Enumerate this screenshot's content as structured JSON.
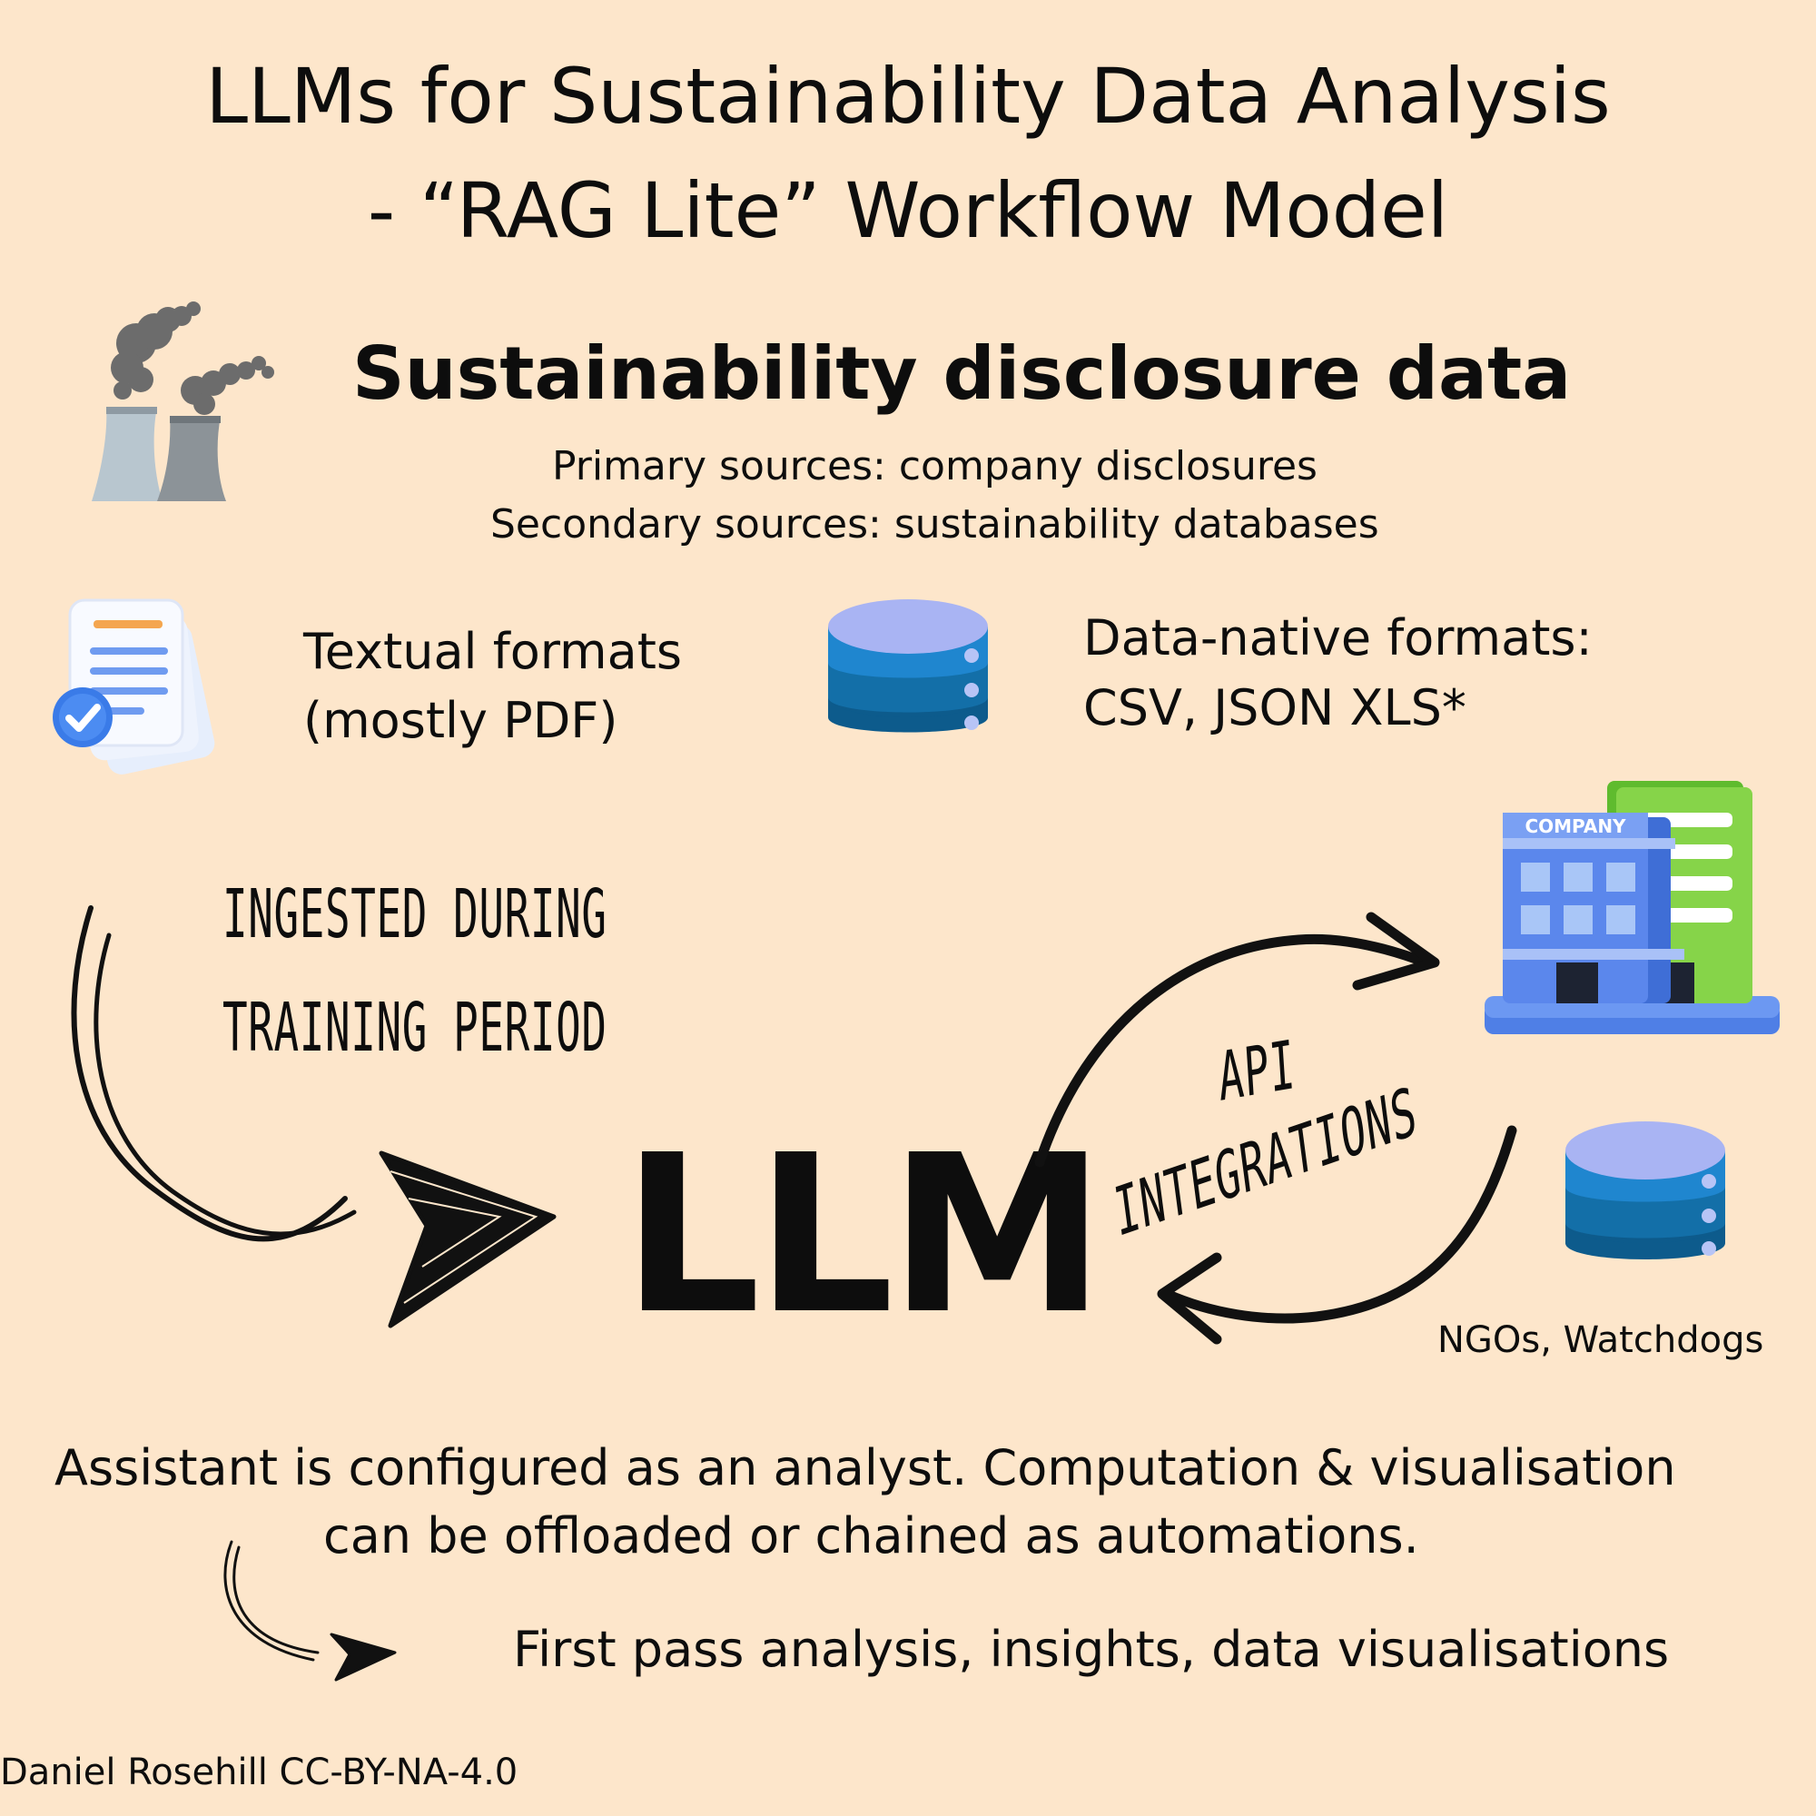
{
  "title": {
    "line1": "LLMs for Sustainability Data Analysis",
    "line2": "- “RAG Lite” Workflow Model"
  },
  "disclosure": {
    "heading": "Sustainability disclosure data",
    "primary": "Primary sources: company disclosures",
    "secondary": "Secondary sources: sustainability databases"
  },
  "formats": {
    "textual_line1": "Textual formats",
    "textual_line2": "(mostly PDF)",
    "native_line1": "Data-native formats:",
    "native_line2": "CSV, JSON XLS*"
  },
  "flow": {
    "ingested_line1": "INGESTED DURING",
    "ingested_line2": "TRAINING PERIOD",
    "llm": "LLM",
    "api_line1": "API",
    "api_line2": "INTEGRATIONS",
    "company_sign": "COMPANY",
    "ngos": "NGOs, Watchdogs"
  },
  "bottom": {
    "assistant_line1": "Assistant is configured as an analyst. Computation & visualisation",
    "assistant_line2": "can be offloaded or chained as automations.",
    "output": "First pass analysis, insights, data visualisations",
    "credit": "Daniel Rosehill CC-BY-NA-4.0"
  },
  "colors": {
    "background": "#fde6cb",
    "text": "#0d0d0d",
    "db_top": "#a9b4f3",
    "db_blue": "#1f86cf",
    "building_blue": "#4e7de0",
    "building_green": "#7ccd3f"
  }
}
